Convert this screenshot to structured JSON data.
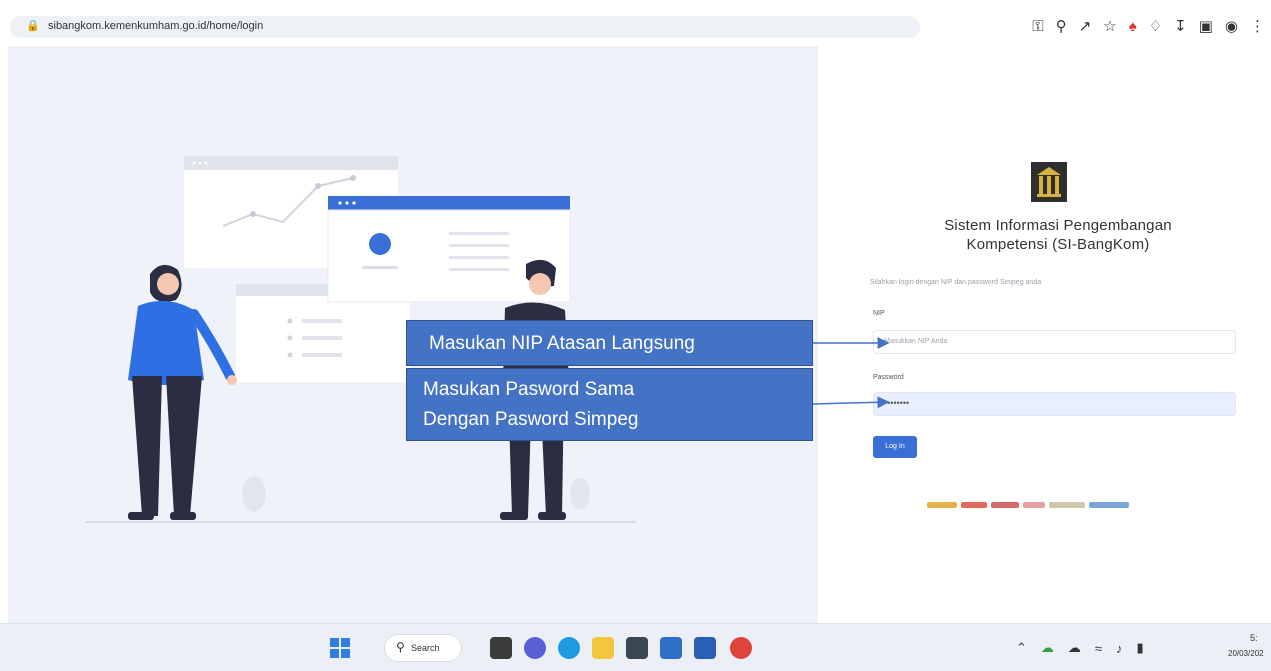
{
  "browser": {
    "url_domain": "sibangkom.kemenkumham.go.id/home/login",
    "lock_icon": "lock-icon",
    "toolbar_icons": [
      "key-icon",
      "zoom-icon",
      "share-icon",
      "star-icon",
      "extension-icon",
      "puzzle-icon",
      "download-icon",
      "sidepanel-icon",
      "avatar-icon",
      "menu-icon"
    ]
  },
  "login": {
    "title_line1": "Sistem Informasi Pengembangan",
    "title_line2": "Kompetensi (SI-BangKom)",
    "subtitle": "Silahkan login dengan NIP dan password Simpeg anda",
    "nip_label": "NIP",
    "nip_placeholder": "Masukkan NIP Anda",
    "password_label": "Password",
    "password_value": "••••••••",
    "button_label": "Log In"
  },
  "annotations": {
    "nip_note": "Masukan NIP Atasan Langsung",
    "password_note_line1": "Masukan Pasword Sama",
    "password_note_line2": "Dengan Pasword Simpeg"
  },
  "taskbar": {
    "search_label": "Search",
    "clock_time": "5:",
    "clock_date": "20/03/202"
  },
  "colors": {
    "accent": "#3b6fd8",
    "callout": "#4472c4",
    "hero_bg": "#eff2f8",
    "figure_blue": "#2f6fe4",
    "figure_dark": "#2b2d42"
  }
}
